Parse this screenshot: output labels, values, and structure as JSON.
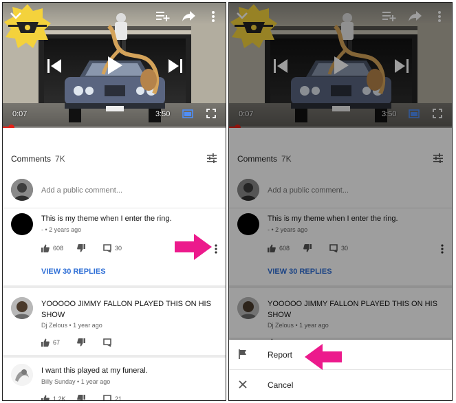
{
  "video": {
    "current_time": "0:07",
    "duration": "3:50",
    "progress_fraction": 0.03
  },
  "comments": {
    "title": "Comments",
    "count": "7K",
    "add_placeholder": "Add a public comment...",
    "items": [
      {
        "text": "This is my theme when I enter the ring.",
        "author": "-",
        "time": "2 years ago",
        "likes": "608",
        "replies": "30",
        "view_replies": "VIEW 30 REPLIES"
      },
      {
        "text": "YOOOOO JIMMY FALLON PLAYED THIS ON HIS SHOW",
        "author": "Dj Zelous",
        "time": "1 year ago",
        "likes": "67",
        "replies": ""
      },
      {
        "text": "I want this played at my funeral.",
        "author": "Billy Sunday",
        "time": "1 year ago",
        "likes": "1.2K",
        "replies": "21"
      }
    ]
  },
  "action_sheet": {
    "report_label": "Report",
    "cancel_label": "Cancel"
  },
  "icons": {
    "collapse": "chevron-down-icon",
    "add_to_playlist": "playlist-add-icon",
    "share": "share-icon",
    "more": "more-vertical-icon",
    "previous": "skip-previous-icon",
    "play": "play-icon",
    "next": "skip-next-icon",
    "cast": "cast-icon",
    "fullscreen": "fullscreen-icon",
    "sort": "sort-icon",
    "like": "thumb-up-icon",
    "dislike": "thumb-down-icon",
    "reply": "comment-icon",
    "report": "flag-icon",
    "cancel": "close-icon"
  },
  "colors": {
    "accent_blue": "#2f6fd6",
    "progress_red": "#e62117",
    "annotation_pink": "#ec1a8c"
  }
}
